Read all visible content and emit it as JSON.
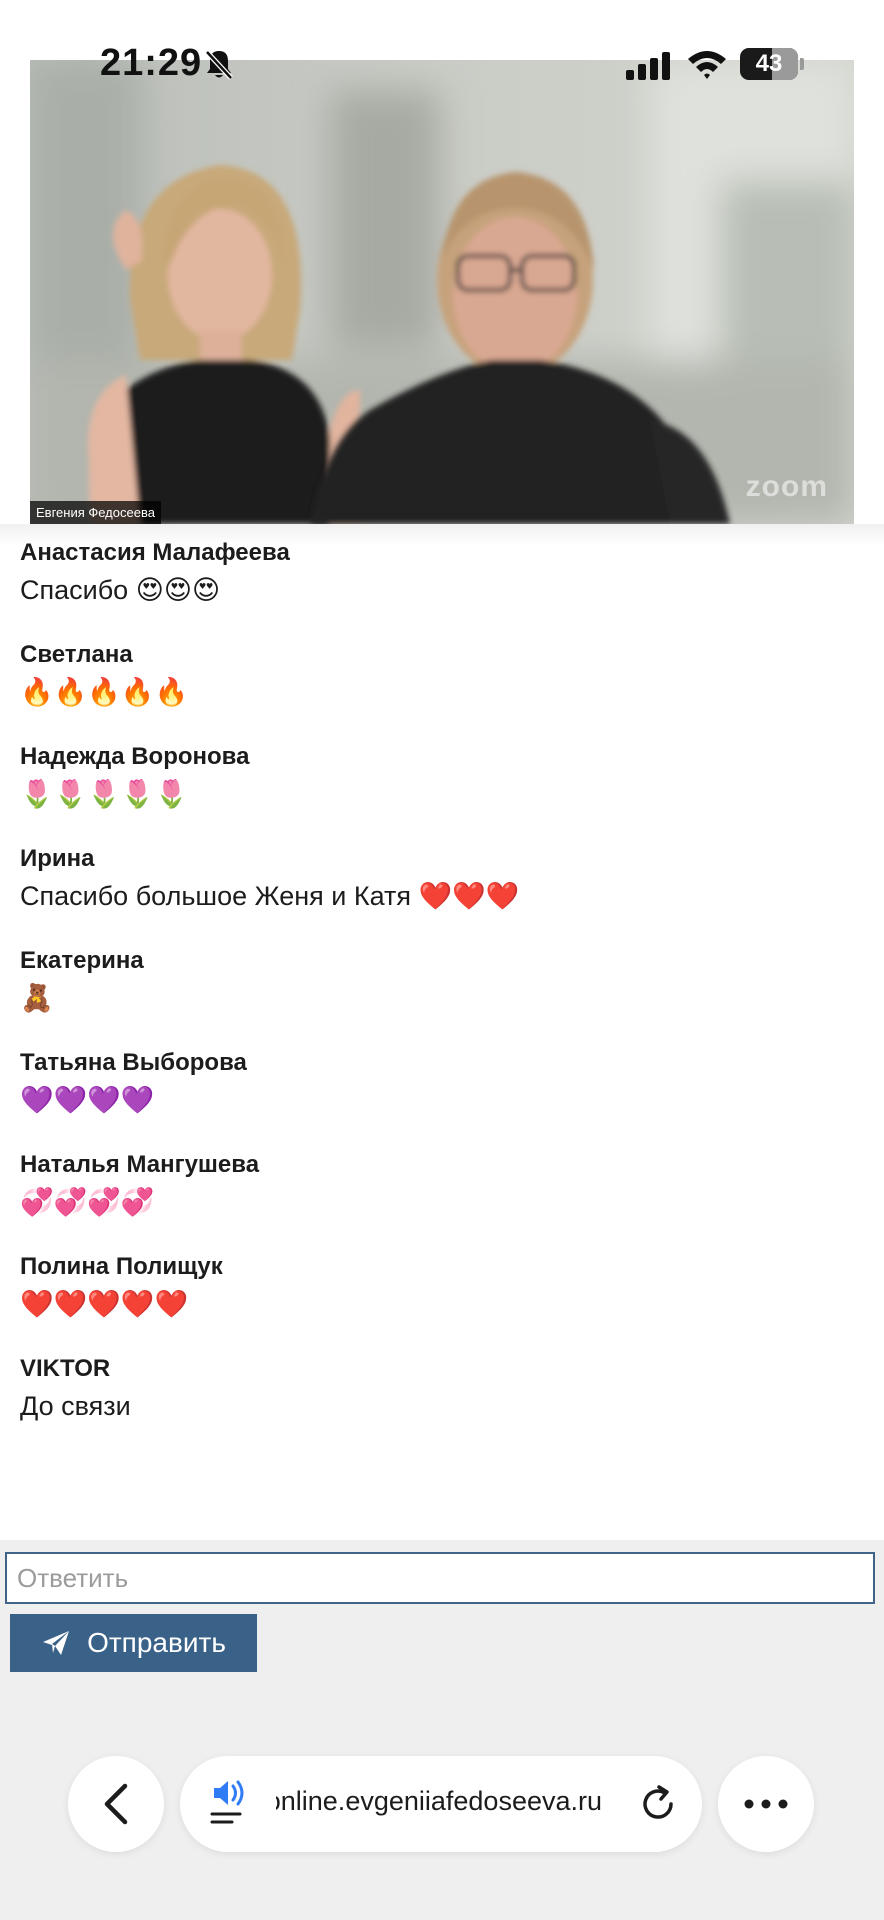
{
  "status_bar": {
    "time": "21:29",
    "battery": "43",
    "icons": [
      "bell-slash-icon",
      "signal-icon",
      "wifi-icon",
      "battery-icon"
    ]
  },
  "video": {
    "caption": "Евгения Федосеева",
    "watermark": "zoom"
  },
  "chat": {
    "messages": [
      {
        "author": "Анастасия Малафеева",
        "text": "Спасибо 😍😍😍"
      },
      {
        "author": "Светлана",
        "text": "🔥🔥🔥🔥🔥"
      },
      {
        "author": "Надежда Воронова",
        "text": "🌷🌷🌷🌷🌷"
      },
      {
        "author": "Ирина",
        "text": "Спасибо большое Женя и Катя ❤️❤️❤️"
      },
      {
        "author": "Екатерина",
        "text": "🧸"
      },
      {
        "author": "Татьяна Выборова",
        "text": "💜💜💜💜"
      },
      {
        "author": "Наталья Мангушева",
        "text": "💞💞💞💞"
      },
      {
        "author": "Полина Полищук",
        "text": "❤️❤️❤️❤️❤️"
      },
      {
        "author": "VIKTOR",
        "text": "До связи"
      }
    ]
  },
  "reply": {
    "placeholder": "Ответить",
    "value": "",
    "send_label": "Отправить",
    "send_icon": "paper-plane-icon"
  },
  "browser": {
    "url": "online.evgeniiafedoseeva.ru",
    "icons": [
      "back-icon",
      "speaker-icon",
      "reload-icon",
      "more-icon"
    ]
  },
  "colors": {
    "accent": "#3a6188",
    "input_border": "#3f6488",
    "reply_area_bg": "#efefef"
  }
}
